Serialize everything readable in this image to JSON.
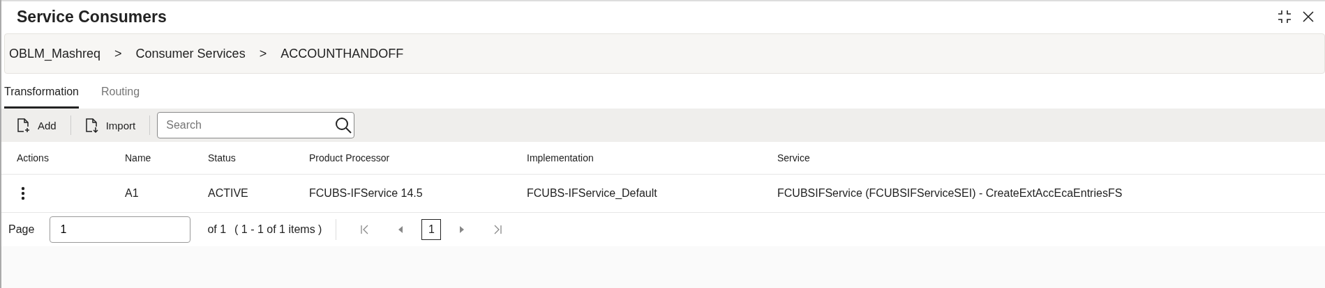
{
  "window": {
    "title": "Service Consumers"
  },
  "breadcrumb": [
    {
      "label": "OBLM_Mashreq",
      "separator": ">"
    },
    {
      "label": "Consumer Services",
      "separator": ">"
    },
    {
      "label": "ACCOUNTHANDOFF"
    }
  ],
  "tabs": [
    {
      "label": "Transformation",
      "selected": true
    },
    {
      "label": "Routing",
      "selected": false
    }
  ],
  "toolbar": {
    "buttons": [
      {
        "label": "Add",
        "kind": "add"
      },
      {
        "label": "Import",
        "kind": "import"
      }
    ],
    "search": {
      "placeholder": "Search"
    }
  },
  "table": {
    "columns": [
      "Actions",
      "Name",
      "Status",
      "Product Processor",
      "Implementation",
      "Service"
    ],
    "rows": [
      {
        "cells": [
          "",
          "A1",
          "ACTIVE",
          "FCUBS-IFService 14.5",
          "FCUBS-IFService_Default",
          "FCUBSIFService (FCUBSIFServiceSEI) - CreateExtAccEcaEntriesFS"
        ]
      }
    ]
  },
  "pager": {
    "label": "Page",
    "value": "1",
    "of": "of 1",
    "range": "( 1 - 1 of 1 items )",
    "current": "1"
  }
}
